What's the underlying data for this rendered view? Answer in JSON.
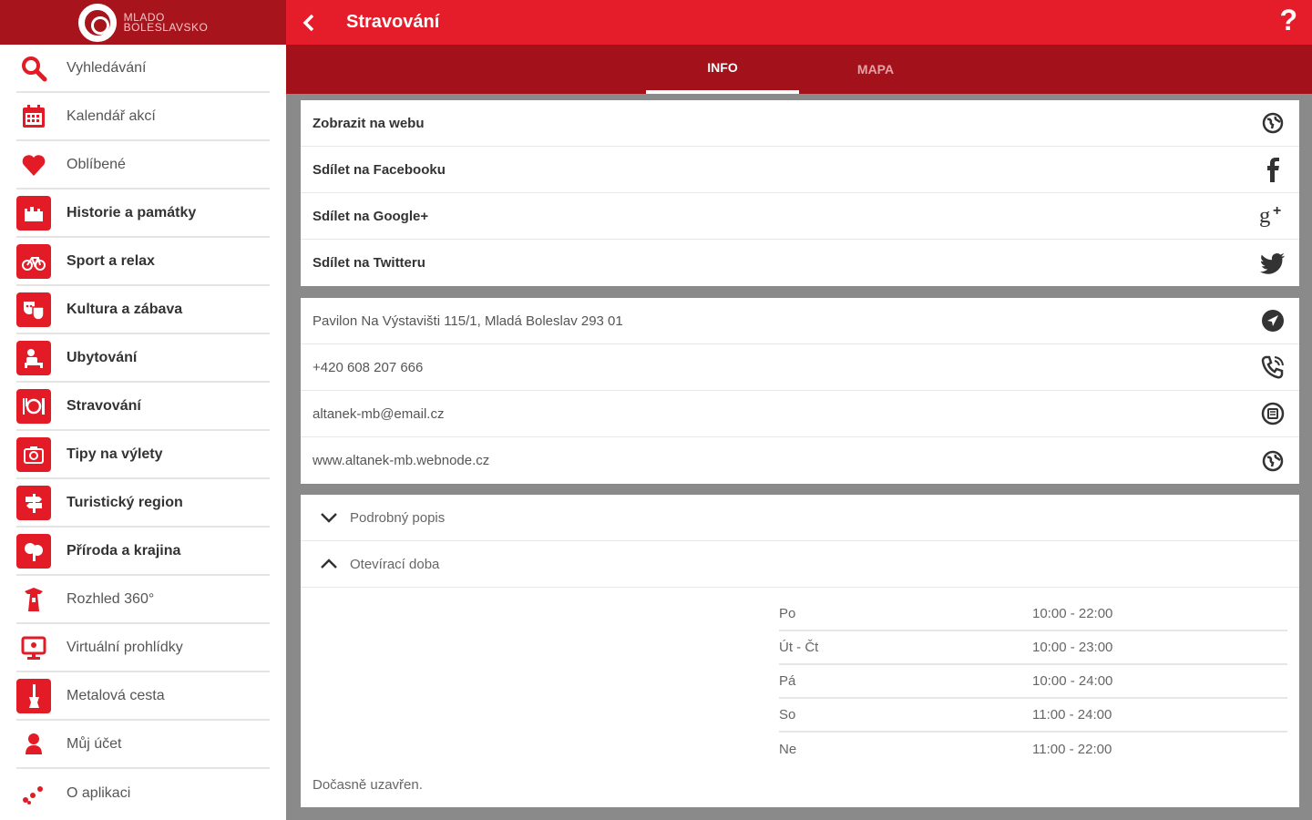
{
  "brand": {
    "line1": "MLADO",
    "line2": "BOLESLAVSKO"
  },
  "sidebar": {
    "items": [
      {
        "label": "Vyhledávání",
        "icon": "search-icon"
      },
      {
        "label": "Kalendář akcí",
        "icon": "calendar-icon"
      },
      {
        "label": "Oblíbené",
        "icon": "heart-icon"
      },
      {
        "label": "Historie a památky",
        "icon": "castle-icon"
      },
      {
        "label": "Sport a relax",
        "icon": "bicycle-icon"
      },
      {
        "label": "Kultura a zábava",
        "icon": "theater-masks-icon"
      },
      {
        "label": "Ubytování",
        "icon": "bed-icon"
      },
      {
        "label": "Stravování",
        "icon": "cutlery-icon"
      },
      {
        "label": "Tipy na výlety",
        "icon": "camera-icon"
      },
      {
        "label": "Turistický region",
        "icon": "signpost-icon"
      },
      {
        "label": "Příroda a krajina",
        "icon": "tree-icon"
      },
      {
        "label": "Rozhled 360°",
        "icon": "lookout-tower-icon"
      },
      {
        "label": "Virtuální prohlídky",
        "icon": "monitor-icon"
      },
      {
        "label": "Metalová cesta",
        "icon": "guitar-icon"
      },
      {
        "label": "Můj účet",
        "icon": "user-icon"
      },
      {
        "label": "O aplikaci",
        "icon": "dots-icon"
      }
    ]
  },
  "header": {
    "title": "Stravování",
    "help": "?"
  },
  "tabs": [
    {
      "label": "INFO"
    },
    {
      "label": "MAPA"
    }
  ],
  "share": [
    {
      "label": "Zobrazit na webu",
      "icon": "globe-icon"
    },
    {
      "label": "Sdílet na Facebooku",
      "icon": "facebook-icon"
    },
    {
      "label": "Sdílet na Google+",
      "icon": "google-plus-icon"
    },
    {
      "label": "Sdílet na Twitteru",
      "icon": "twitter-icon"
    }
  ],
  "contact": [
    {
      "label": "Pavilon Na Výstavišti 115/1, Mladá Boleslav 293 01",
      "icon": "navigation-icon"
    },
    {
      "label": "+420 608 207 666",
      "icon": "phone-icon"
    },
    {
      "label": "altanek-mb@email.cz",
      "icon": "email-icon"
    },
    {
      "label": "www.altanek-mb.webnode.cz",
      "icon": "globe-icon"
    }
  ],
  "details": {
    "description_label": "Podrobný popis",
    "hours_label": "Otevírací doba",
    "hours": [
      {
        "day": "Po",
        "time": "10:00 - 22:00"
      },
      {
        "day": "Út - Čt",
        "time": "10:00 - 23:00"
      },
      {
        "day": "Pá",
        "time": "10:00 - 24:00"
      },
      {
        "day": "So",
        "time": "11:00 - 24:00"
      },
      {
        "day": "Ne",
        "time": "11:00 - 22:00"
      }
    ],
    "note": "Dočasně uzavřen."
  },
  "colors": {
    "primary": "#e51d2a",
    "dark": "#a3121b",
    "background": "#8a8a8a"
  }
}
